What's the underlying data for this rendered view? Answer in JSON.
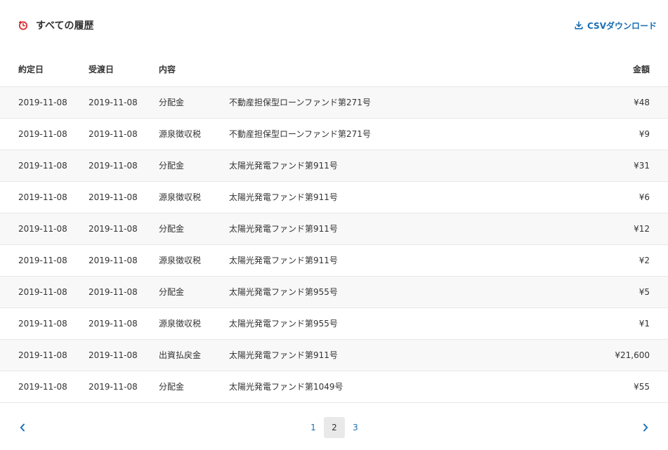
{
  "header": {
    "title": "すべての履歴",
    "csv_label": "CSVダウンロード",
    "accent": "#d93036",
    "link_color": "#1a6fb5"
  },
  "table": {
    "columns": {
      "date": "約定日",
      "delivery": "受渡日",
      "type": "内容",
      "amount": "金額"
    },
    "rows": [
      {
        "date": "2019-11-08",
        "delivery": "2019-11-08",
        "type": "分配金",
        "desc": "不動産担保型ローンファンド第271号",
        "amount": "¥48"
      },
      {
        "date": "2019-11-08",
        "delivery": "2019-11-08",
        "type": "源泉徴収税",
        "desc": "不動産担保型ローンファンド第271号",
        "amount": "¥9"
      },
      {
        "date": "2019-11-08",
        "delivery": "2019-11-08",
        "type": "分配金",
        "desc": "太陽光発電ファンド第911号",
        "amount": "¥31"
      },
      {
        "date": "2019-11-08",
        "delivery": "2019-11-08",
        "type": "源泉徴収税",
        "desc": "太陽光発電ファンド第911号",
        "amount": "¥6"
      },
      {
        "date": "2019-11-08",
        "delivery": "2019-11-08",
        "type": "分配金",
        "desc": "太陽光発電ファンド第911号",
        "amount": "¥12"
      },
      {
        "date": "2019-11-08",
        "delivery": "2019-11-08",
        "type": "源泉徴収税",
        "desc": "太陽光発電ファンド第911号",
        "amount": "¥2"
      },
      {
        "date": "2019-11-08",
        "delivery": "2019-11-08",
        "type": "分配金",
        "desc": "太陽光発電ファンド第955号",
        "amount": "¥5"
      },
      {
        "date": "2019-11-08",
        "delivery": "2019-11-08",
        "type": "源泉徴収税",
        "desc": "太陽光発電ファンド第955号",
        "amount": "¥1"
      },
      {
        "date": "2019-11-08",
        "delivery": "2019-11-08",
        "type": "出資払戻金",
        "desc": "太陽光発電ファンド第911号",
        "amount": "¥21,600"
      },
      {
        "date": "2019-11-08",
        "delivery": "2019-11-08",
        "type": "分配金",
        "desc": "太陽光発電ファンド第1049号",
        "amount": "¥55"
      }
    ]
  },
  "pagination": {
    "pages": [
      "1",
      "2",
      "3"
    ],
    "current": "2",
    "prev_icon": "chevron-left-icon",
    "next_icon": "chevron-right-icon"
  }
}
